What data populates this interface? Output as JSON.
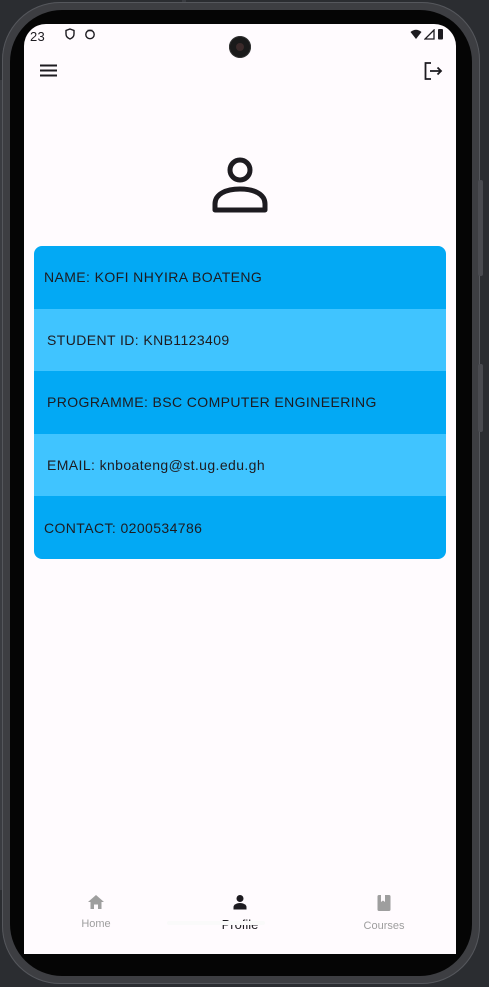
{
  "status_bar": {
    "time": "23"
  },
  "profile": {
    "name_label": "NAME: KOFI NHYIRA BOATENG",
    "student_id_label": "STUDENT ID: KNB1123409",
    "programme_label": "PROGRAMME: BSC COMPUTER ENGINEERING",
    "email_label": "EMAIL: knboateng@st.ug.edu.gh",
    "contact_label": "CONTACT: 0200534786"
  },
  "bottom_nav": {
    "items": [
      {
        "label": "Home",
        "icon": "home-icon",
        "active": false
      },
      {
        "label": "Profile",
        "icon": "person-icon",
        "active": true
      },
      {
        "label": "Courses",
        "icon": "book-icon",
        "active": false
      }
    ]
  },
  "colors": {
    "row_dark": "#03a9f4",
    "row_light": "#40c4ff",
    "screen_bg": "#fffbfe"
  }
}
